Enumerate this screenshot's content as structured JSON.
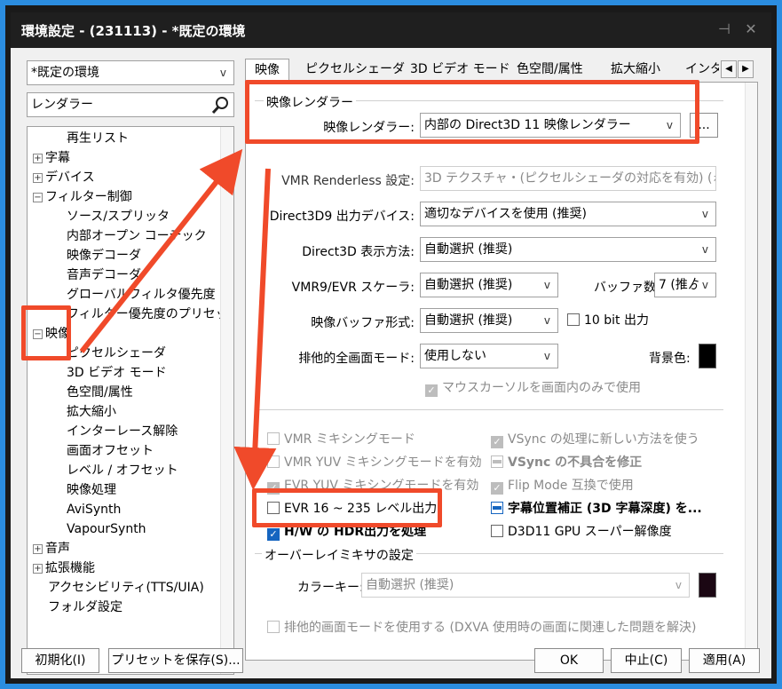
{
  "window": {
    "title": "環境設定 - (231113) - *既定の環境"
  },
  "left": {
    "preset_value": "*既定の環境",
    "search_value": "レンダラー",
    "tree": [
      {
        "label": "再生リスト",
        "indent": 2,
        "expander": ""
      },
      {
        "label": "字幕",
        "indent": 1,
        "expander": "+"
      },
      {
        "label": "デバイス",
        "indent": 1,
        "expander": "+"
      },
      {
        "label": "フィルター制御",
        "indent": 1,
        "expander": "−"
      },
      {
        "label": "ソース/スプリッタ",
        "indent": 2,
        "expander": ""
      },
      {
        "label": "内部オープン コーデック",
        "indent": 2,
        "expander": ""
      },
      {
        "label": "映像デコーダ",
        "indent": 2,
        "expander": ""
      },
      {
        "label": "音声デコーダ",
        "indent": 2,
        "expander": ""
      },
      {
        "label": "グローバルフィルタ優先度",
        "indent": 2,
        "expander": ""
      },
      {
        "label": "フィルター優先度のプリセット",
        "indent": 2,
        "expander": ""
      },
      {
        "label": "映像",
        "indent": 1,
        "expander": "−"
      },
      {
        "label": "ピクセルシェーダ",
        "indent": 2,
        "expander": ""
      },
      {
        "label": "3D ビデオ モード",
        "indent": 2,
        "expander": ""
      },
      {
        "label": "色空間/属性",
        "indent": 2,
        "expander": ""
      },
      {
        "label": "拡大縮小",
        "indent": 2,
        "expander": ""
      },
      {
        "label": "インターレース解除",
        "indent": 2,
        "expander": ""
      },
      {
        "label": "画面オフセット",
        "indent": 2,
        "expander": ""
      },
      {
        "label": "レベル / オフセット",
        "indent": 2,
        "expander": ""
      },
      {
        "label": "映像処理",
        "indent": 2,
        "expander": ""
      },
      {
        "label": "AviSynth",
        "indent": 2,
        "expander": ""
      },
      {
        "label": "VapourSynth",
        "indent": 2,
        "expander": ""
      },
      {
        "label": "音声",
        "indent": 1,
        "expander": "+"
      },
      {
        "label": "拡張機能",
        "indent": 1,
        "expander": "+"
      },
      {
        "label": "アクセシビリティ(TTS/UIA)",
        "indent": 1,
        "expander": ""
      },
      {
        "label": "フォルダ設定",
        "indent": 1,
        "expander": ""
      }
    ]
  },
  "tabs": [
    "映像",
    "ピクセルシェーダ",
    "3D ビデオ モード",
    "色空間/属性",
    "拡大縮小",
    "インタ"
  ],
  "renderer_group": {
    "title": "映像レンダラー",
    "label": "映像レンダラー:",
    "value": "内部の Direct3D 11 映像レンダラー",
    "more_button": "..."
  },
  "settings": {
    "vmr_renderless": {
      "label": "VMR Renderless 設定:",
      "value": "3D テクスチャ・(ピクセルシェーダの対応を有効) (ゎ"
    },
    "d3d9_device": {
      "label": "Direct3D9 出力デバイス:",
      "value": "適切なデバイスを使用 (推奨)"
    },
    "d3d_display": {
      "label": "Direct3D 表示方法:",
      "value": "自動選択 (推奨)"
    },
    "scaler": {
      "label": "VMR9/EVR スケーラ:",
      "value": "自動選択 (推奨)"
    },
    "buffers": {
      "label": "バッファ数:",
      "value": "7 (推ゟ"
    },
    "buffer_format": {
      "label": "映像バッファ形式:",
      "value": "自動選択 (推奨)"
    },
    "ten_bit": {
      "label": "10 bit 出力"
    },
    "exclusive_mode": {
      "label": "排他的全画面モード:",
      "value": "使用しない"
    },
    "bg_color": {
      "label": "背景色:"
    },
    "mouse_cursor": {
      "label": "マウスカーソルを画面内のみで使用"
    }
  },
  "checks_left": [
    {
      "label": "VMR ミキシングモード",
      "state": "unchecked",
      "enabled": false,
      "bold": false
    },
    {
      "label": "VMR YUV ミキシングモードを有効",
      "state": "unchecked",
      "enabled": false,
      "bold": false
    },
    {
      "label": "EVR YUV ミキシングモードを有効",
      "state": "checked",
      "enabled": false,
      "bold": false
    },
    {
      "label": "EVR 16 ~ 235 レベル出力",
      "state": "unchecked",
      "enabled": true,
      "bold": false
    },
    {
      "label": "H/W の HDR出力を処理",
      "state": "checked",
      "enabled": true,
      "bold": true
    }
  ],
  "checks_right": [
    {
      "label": "VSync の処理に新しい方法を使う",
      "state": "checked",
      "enabled": false,
      "bold": false
    },
    {
      "label": "VSync の不具合を修正",
      "state": "indeterminate",
      "enabled": false,
      "bold": true
    },
    {
      "label": "Flip Mode 互換で使用",
      "state": "checked",
      "enabled": false,
      "bold": false
    },
    {
      "label": "字幕位置補正 (3D 字幕深度) を...",
      "state": "indeterminate",
      "enabled": true,
      "bold": true
    },
    {
      "label": "D3D11 GPU スーパー解像度",
      "state": "unchecked",
      "enabled": true,
      "bold": false
    }
  ],
  "overlay_group": {
    "title": "オーバーレイミキサの設定",
    "colorkey_label": "カラーキー:",
    "colorkey_value": "自動選択 (推奨)",
    "exclusive_check": "排他的画面モードを使用する (DXVA 使用時の画面に関連した問題を解決)"
  },
  "buttons": {
    "reset": "初期化(I)",
    "save_preset": "プリセットを保存(S)...",
    "ok": "OK",
    "cancel": "中止(C)",
    "apply": "適用(A)"
  },
  "colors": {
    "annotation": "#f04a2a",
    "accent": "#1565c0",
    "titlebar": "#1f1f1f",
    "desktop": "#2b8de0"
  }
}
